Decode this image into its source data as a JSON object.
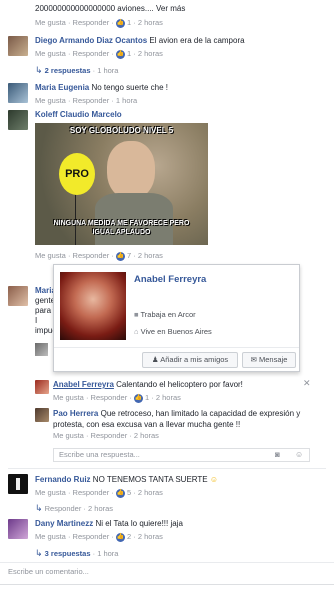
{
  "labels": {
    "like": "Me gusta",
    "reply": "Responder",
    "sep": " · "
  },
  "comments": [
    {
      "name": "",
      "text": "200000000000000000 aviones.... Ver más",
      "likes": "1",
      "time": "2 horas"
    },
    {
      "name": "Diego Armando Diaz Ocantos",
      "text": "El avion era de la campora",
      "likes": "1",
      "time": "2 horas"
    },
    {
      "name": "Maria Eugenia",
      "text": "No tengo suerte che !",
      "time": "1 hora"
    },
    {
      "name": "Koleff Claudio Marcelo",
      "likes": "7",
      "time": "2 horas",
      "meme": {
        "top": "SOY GLOBOLUDO NIVEL 5",
        "badge": "PRO",
        "bottom": "NINGUNA MEDIDA ME FAVORECE PERO IGUAL APLAUDO"
      }
    },
    {
      "name": "Maria",
      "text": "gente para I impue"
    },
    {
      "name": "Anabel Ferreyra",
      "text": "Calentando el helicoptero por favor!",
      "likes": "1",
      "time": "2 horas"
    },
    {
      "name": "Pao Herrera",
      "text": "Que retroceso, han limitado la capacidad de expresión y protesta, con esa excusa van a llevar mucha gente !!",
      "time": "2 horas"
    },
    {
      "name": "Fernando Ruiz",
      "text": "NO TENEMOS TANTA SUERTE",
      "likes": "5",
      "time": "2 horas"
    },
    {
      "name": "Dany Martinezz",
      "text": "Ni el Tata lo quiere!!! jaja",
      "likes": "2",
      "time": "2 horas"
    }
  ],
  "reply_counts": [
    {
      "text": "2 respuestas",
      "time": "1 hora"
    },
    {
      "text": "3 respuestas",
      "time": "1 hora"
    }
  ],
  "standalone_times": {
    "after_fernando": "2 horas"
  },
  "reply_input": {
    "placeholder": "Escribe una respuesta..."
  },
  "comment_input": {
    "placeholder": "Escribe un comentario..."
  },
  "hovercard": {
    "name": "Anabel Ferreyra",
    "work": "Trabaja en Arcor",
    "city": "Vive en Buenos Aires",
    "add_friend": "Añadir a mis amigos",
    "message": "Mensaje"
  },
  "colors": {
    "link": "#365899",
    "meta": "#90949c",
    "like": "#4267b2"
  }
}
